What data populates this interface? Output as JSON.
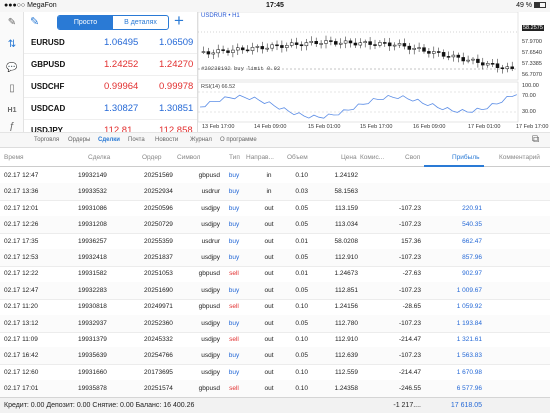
{
  "status_bar": {
    "carrier": "●●●○○ MegaFon",
    "time": "17:45",
    "battery": "49 %",
    "battery_level": 0.49
  },
  "left_toolbar": {
    "items": [
      {
        "name": "edit-icon",
        "glyph": "✎"
      },
      {
        "name": "trade-icon",
        "glyph": "⇅"
      },
      {
        "name": "chat-icon",
        "glyph": "💬"
      },
      {
        "name": "document-icon",
        "glyph": "▯"
      },
      {
        "name": "timeframe-label",
        "glyph": "H1"
      },
      {
        "name": "indicators-icon",
        "glyph": "ƒ"
      },
      {
        "name": "objects-icon",
        "glyph": "⟋"
      }
    ]
  },
  "quotes": {
    "mode_simple": "Просто",
    "mode_detailed": "В деталях",
    "rows": [
      {
        "symbol": "EURUSD",
        "bid": "1.06495",
        "ask": "1.06509",
        "dir": "up"
      },
      {
        "symbol": "GBPUSD",
        "bid": "1.24252",
        "ask": "1.24270",
        "dir": "down"
      },
      {
        "symbol": "USDCHF",
        "bid": "0.99964",
        "ask": "0.99978",
        "dir": "down"
      },
      {
        "symbol": "USDCAD",
        "bid": "1.30827",
        "ask": "1.30851",
        "dir": "up"
      },
      {
        "symbol": "USDJPY",
        "bid": "112.81",
        "ask": "112.858",
        "dir": "down"
      }
    ]
  },
  "chart": {
    "title": "USDRUR • H1",
    "order_label": "#20238192 buy limit 0.02",
    "rsi_label": "RSI(14) 66.52",
    "price_ticks": [
      "58.2575",
      "57.9700",
      "57.6540",
      "57.3385",
      "57.0225",
      "56.7070"
    ],
    "current_price": "58.2575",
    "rsi_ticks": [
      "100.00",
      "70.00",
      "30.00"
    ],
    "time_ticks": [
      "13 Feb 17:00",
      "14 Feb 09:00",
      "15 Feb 01:00",
      "15 Feb 17:00",
      "16 Feb 09:00",
      "17 Feb 01:00",
      "17 Feb 17:00"
    ]
  },
  "tabs": [
    {
      "label": "Торговля",
      "active": false
    },
    {
      "label": "Ордеры",
      "active": false
    },
    {
      "label": "Сделки",
      "active": true
    },
    {
      "label": "Почта",
      "active": false
    },
    {
      "label": "Новости",
      "active": false
    },
    {
      "label": "Журнал",
      "active": false
    },
    {
      "label": "О программе",
      "active": false
    }
  ],
  "table": {
    "headers": {
      "time": "Время",
      "deal": "Сделка",
      "order": "Ордер",
      "symbol": "Символ",
      "type": "Тип",
      "direction": "Направ...",
      "volume": "Объем",
      "price": "Цена",
      "commission": "Комис...",
      "swap": "Своп",
      "profit": "Прибыль",
      "comment": "Комментарий"
    },
    "rows": [
      {
        "time": "02.17 12:47",
        "deal": "19932149",
        "order": "20251569",
        "symbol": "gbpusd",
        "type": "buy",
        "dir": "in",
        "volume": "0.10",
        "price": "1.24192",
        "comm": "",
        "swap": "",
        "profit": ""
      },
      {
        "time": "02.17 13:36",
        "deal": "19933532",
        "order": "20252934",
        "symbol": "usdrur",
        "type": "buy",
        "dir": "in",
        "volume": "0.03",
        "price": "58.1563",
        "comm": "",
        "swap": "",
        "profit": ""
      },
      {
        "time": "02.17 12:01",
        "deal": "19931086",
        "order": "20250596",
        "symbol": "usdjpy",
        "type": "buy",
        "dir": "out",
        "volume": "0.05",
        "price": "113.159",
        "comm": "",
        "swap": "-107.23",
        "profit": "220.91"
      },
      {
        "time": "02.17 12:26",
        "deal": "19931208",
        "order": "20250729",
        "symbol": "usdjpy",
        "type": "buy",
        "dir": "out",
        "volume": "0.05",
        "price": "113.034",
        "comm": "",
        "swap": "-107.23",
        "profit": "540.35"
      },
      {
        "time": "02.17 17:35",
        "deal": "19936257",
        "order": "20255359",
        "symbol": "usdrur",
        "type": "buy",
        "dir": "out",
        "volume": "0.01",
        "price": "58.0208",
        "comm": "",
        "swap": "157.36",
        "profit": "662.47"
      },
      {
        "time": "02.17 12:53",
        "deal": "19932418",
        "order": "20251837",
        "symbol": "usdjpy",
        "type": "buy",
        "dir": "out",
        "volume": "0.05",
        "price": "112.910",
        "comm": "",
        "swap": "-107.23",
        "profit": "857.96"
      },
      {
        "time": "02.17 12:22",
        "deal": "19931582",
        "order": "20251053",
        "symbol": "gbpusd",
        "type": "sell",
        "dir": "out",
        "volume": "0.01",
        "price": "1.24673",
        "comm": "",
        "swap": "-27.63",
        "profit": "902.97"
      },
      {
        "time": "02.17 12:47",
        "deal": "19932283",
        "order": "20251690",
        "symbol": "usdjpy",
        "type": "buy",
        "dir": "out",
        "volume": "0.05",
        "price": "112.851",
        "comm": "",
        "swap": "-107.23",
        "profit": "1 009.67"
      },
      {
        "time": "02.17 11:20",
        "deal": "19930818",
        "order": "20249971",
        "symbol": "gbpusd",
        "type": "sell",
        "dir": "out",
        "volume": "0.10",
        "price": "1.24156",
        "comm": "",
        "swap": "-28.65",
        "profit": "1 059.92"
      },
      {
        "time": "02.17 13:12",
        "deal": "19932937",
        "order": "20252360",
        "symbol": "usdjpy",
        "type": "buy",
        "dir": "out",
        "volume": "0.05",
        "price": "112.780",
        "comm": "",
        "swap": "-107.23",
        "profit": "1 193.84"
      },
      {
        "time": "02.17 11:09",
        "deal": "19931379",
        "order": "20245332",
        "symbol": "usdjpy",
        "type": "sell",
        "dir": "out",
        "volume": "0.10",
        "price": "112.910",
        "comm": "",
        "swap": "-214.47",
        "profit": "1 321.61"
      },
      {
        "time": "02.17 16:42",
        "deal": "19935639",
        "order": "20254766",
        "symbol": "usdjpy",
        "type": "buy",
        "dir": "out",
        "volume": "0.05",
        "price": "112.639",
        "comm": "",
        "swap": "-107.23",
        "profit": "1 563.83"
      },
      {
        "time": "02.17 12:60",
        "deal": "19931660",
        "order": "20173695",
        "symbol": "usdjpy",
        "type": "buy",
        "dir": "out",
        "volume": "0.10",
        "price": "112.559",
        "comm": "",
        "swap": "-214.47",
        "profit": "1 670.98"
      },
      {
        "time": "02.17 17:01",
        "deal": "19935878",
        "order": "20251574",
        "symbol": "gbpusd",
        "type": "sell",
        "dir": "out",
        "volume": "0.10",
        "price": "1.24358",
        "comm": "",
        "swap": "-246.55",
        "profit": "6 577.96"
      }
    ]
  },
  "footer": {
    "summary": "Кредит: 0.00 Депозит: 0.00 Снятие: 0.00 Баланс: 16 400.26",
    "swap_total": "-1 217....",
    "profit_total": "17 618.05"
  },
  "colors": {
    "accent": "#2a7ad5",
    "up": "#2468d6",
    "down": "#e23030"
  }
}
